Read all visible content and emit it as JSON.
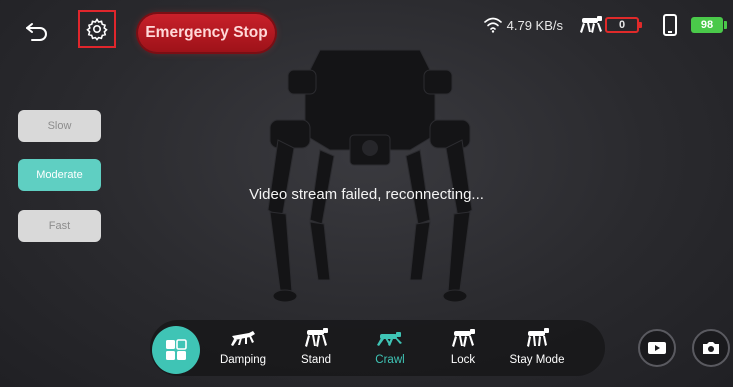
{
  "topbar": {
    "back_icon": "back-arrow-icon",
    "settings_icon": "gear-icon",
    "emergency_stop_label": "Emergency Stop",
    "network_speed": "4.79 KB/s",
    "robot_battery": "0",
    "phone_battery": "98"
  },
  "speed_buttons": {
    "slow": "Slow",
    "moderate": "Moderate",
    "fast": "Fast",
    "selected": "Moderate"
  },
  "video": {
    "status_message": "Video stream failed, reconnecting..."
  },
  "modes": [
    {
      "label": "Damping",
      "icon": "dog-damping-icon",
      "active": false
    },
    {
      "label": "Stand",
      "icon": "dog-stand-icon",
      "active": false
    },
    {
      "label": "Crawl",
      "icon": "dog-crawl-icon",
      "active": true
    },
    {
      "label": "Lock",
      "icon": "dog-lock-icon",
      "active": false
    },
    {
      "label": "Stay Mode",
      "icon": "dog-stay-icon",
      "active": false
    }
  ],
  "actions": {
    "record_icon": "video-record-icon",
    "camera_icon": "camera-icon"
  },
  "colors": {
    "accent": "#3fc4b5",
    "emergency": "#c8202a",
    "battery_low": "#e02a2a",
    "battery_ok": "#4ac94a"
  }
}
